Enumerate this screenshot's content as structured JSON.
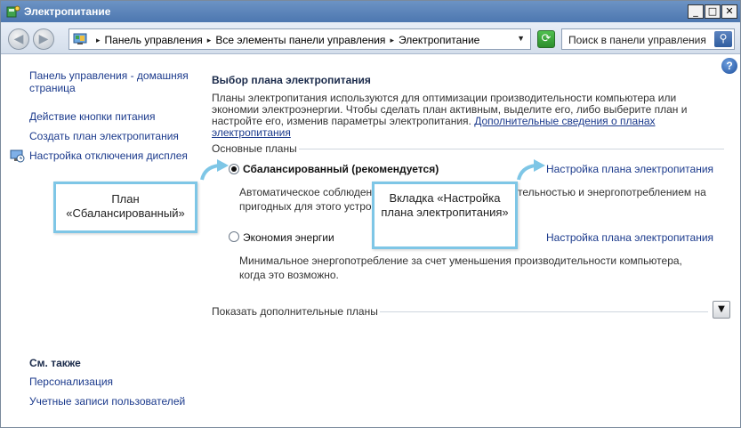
{
  "window": {
    "title": "Электропитание",
    "min_label": "_",
    "max_label": "□",
    "close_label": "✕"
  },
  "navbar": {
    "back_glyph": "◀",
    "forward_glyph": "▶",
    "breadcrumbs": [
      "Панель управления",
      "Все элементы панели управления",
      "Электропитание"
    ],
    "refresh_glyph": "⟳",
    "search_placeholder": "Поиск в панели управления",
    "search_glyph": "⚲",
    "dropdown_glyph": "▼"
  },
  "help_label": "?",
  "sidebar": {
    "home_link": "Панель управления - домашняя страница",
    "links": [
      "Действие кнопки питания",
      "Создать план электропитания",
      "Настройка отключения дисплея"
    ],
    "see_also_heading": "См. также",
    "see_also": [
      "Персонализация",
      "Учетные записи пользователей"
    ]
  },
  "main": {
    "title": "Выбор плана электропитания",
    "intro": "Планы электропитания используются для оптимизации производительности компьютера или экономии электроэнергии. Чтобы сделать план активным, выделите его, либо выберите план и настройте его, изменив параметры электропитания.",
    "intro_link": "Дополнительные сведения о планах электропитания",
    "group_label": "Основные планы",
    "plans": [
      {
        "name": "Сбалансированный (рекомендуется)",
        "selected": true,
        "link": "Настройка плана электропитания",
        "description": "Автоматическое соблюдение баланса между производительностью и энергопотреблением на пригодных для этого устройствах."
      },
      {
        "name": "Экономия энергии",
        "selected": false,
        "link": "Настройка плана электропитания",
        "description": "Минимальное энергопотребление за счет уменьшения производительности компьютера, когда это возможно."
      }
    ],
    "more_plans_label": "Показать дополнительные планы",
    "more_plans_glyph": "▼"
  },
  "callouts": {
    "plan": "План «Сбалансированный»",
    "settings_tab": "Вкладка «Настройка плана электропитания»"
  },
  "colors": {
    "link": "#1b3a8c",
    "callout_border": "#7ec6e6",
    "titlebar": "#5a82b8"
  }
}
